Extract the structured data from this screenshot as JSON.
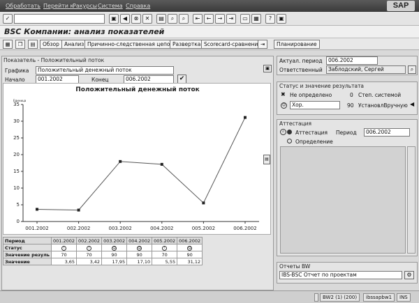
{
  "menu": [
    "Обработать",
    "Перейти к",
    "Ракурсы",
    "Система",
    "Справка"
  ],
  "brand": "SAP",
  "title": "BSC Компании: анализ показателей",
  "app_toolbar": {
    "overview": "Обзор",
    "analysis": "Анализ",
    "cause_chain": "Причинно-следственная цепочка",
    "drilldown": "Развертка",
    "scorecard_compare": "Scorecard-сравнение",
    "planning": "Планирование"
  },
  "indicator_panel": {
    "title": "Показатель - Положительный поток",
    "graphic_label": "Графика",
    "graphic_value": "Положительный денежный поток",
    "start_label": "Начало",
    "start_value": "001.2002",
    "end_label": "Конец",
    "end_value": "006.2002"
  },
  "chart_data": {
    "type": "line",
    "title": "Положительный денежный поток",
    "ylabel": "Единица",
    "categories": [
      "001.2002",
      "002.2002",
      "003.2002",
      "004.2002",
      "005.2002",
      "006.2002"
    ],
    "values": [
      3.65,
      3.42,
      17.95,
      17.1,
      5.55,
      31.12
    ],
    "ylim": [
      0,
      35
    ],
    "yticks": [
      "0",
      "5",
      "10",
      "15",
      "20",
      "25",
      "30",
      "35"
    ],
    "grid": false,
    "legend": "none",
    "line_color": "#555555"
  },
  "table": {
    "period_label": "Период",
    "periods": [
      "001.2002",
      "002.2002",
      "003.2002",
      "004.2002",
      "005.2002",
      "006.2002"
    ],
    "status_label": "Статус",
    "status_icons": [
      "warning-icon",
      "warning-icon",
      "smile-icon",
      "smile-icon",
      "warning-icon",
      "smile-icon"
    ],
    "result_label": "Значение резуль",
    "results": [
      "70",
      "70",
      "90",
      "90",
      "70",
      "90"
    ],
    "value_label": "Значение",
    "values": [
      "3,65",
      "3,42",
      "17,95",
      "17,10",
      "5,55",
      "31,12"
    ]
  },
  "right_top": {
    "actual_period_label": "Актуал. период",
    "actual_period_value": "006.2002",
    "responsible_label": "Ответственный",
    "responsible_value": "Заблодский, Сергей"
  },
  "status_panel": {
    "title": "Статус и значение результата",
    "undefined_label": "Не определено",
    "undefined_value": "0",
    "system_label": "Степ. системой",
    "select_value": "Хор.",
    "manual_value": "90",
    "manual_label": "УстановлВручную"
  },
  "attestation_panel": {
    "title": "Аттестация",
    "radio_attest": "Аттестация",
    "period_label": "Период",
    "period_value": "006.2002",
    "radio_definition": "Определение"
  },
  "bw_panel": {
    "title": "Отчеты BW",
    "report_value": "IBS-BSC Отчет по проектам"
  },
  "statusbar": {
    "system": "BW2 (1) (200)",
    "server": "ibssapbw1",
    "mode": "INS"
  }
}
